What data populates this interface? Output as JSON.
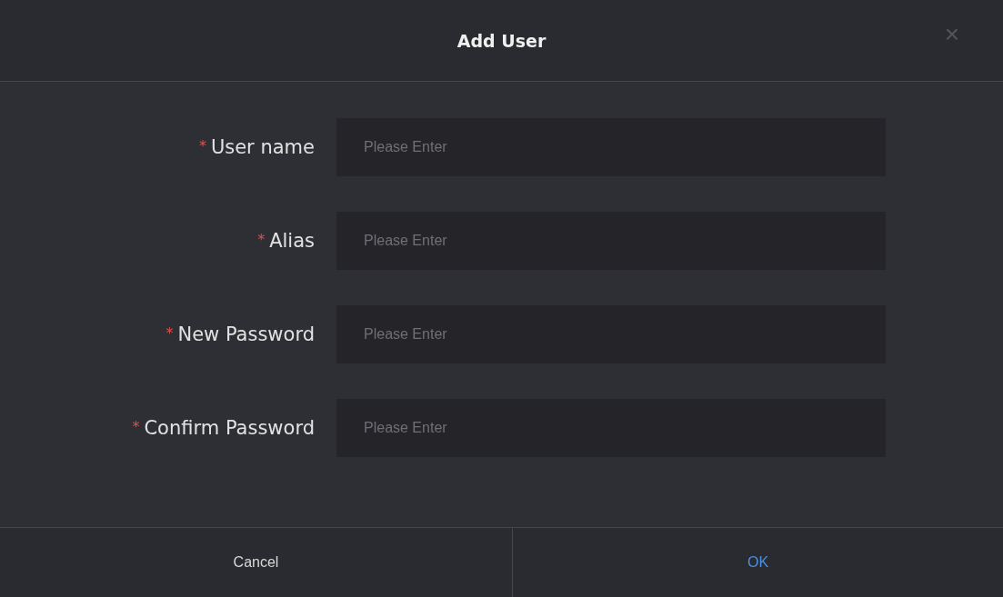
{
  "dialog": {
    "title": "Add User",
    "close": "×"
  },
  "fields": [
    {
      "required_mark": "*",
      "label": "User name",
      "placeholder": "Please Enter"
    },
    {
      "required_mark": "*",
      "label": "Alias",
      "placeholder": "Please Enter"
    },
    {
      "required_mark": "*",
      "label": "New Password",
      "placeholder": "Please Enter"
    },
    {
      "required_mark": "*",
      "label": "Confirm Password",
      "placeholder": "Please Enter"
    }
  ],
  "buttons": [
    {
      "label": "Cancel",
      "kind": "secondary"
    },
    {
      "label": "OK",
      "kind": "primary"
    }
  ]
}
